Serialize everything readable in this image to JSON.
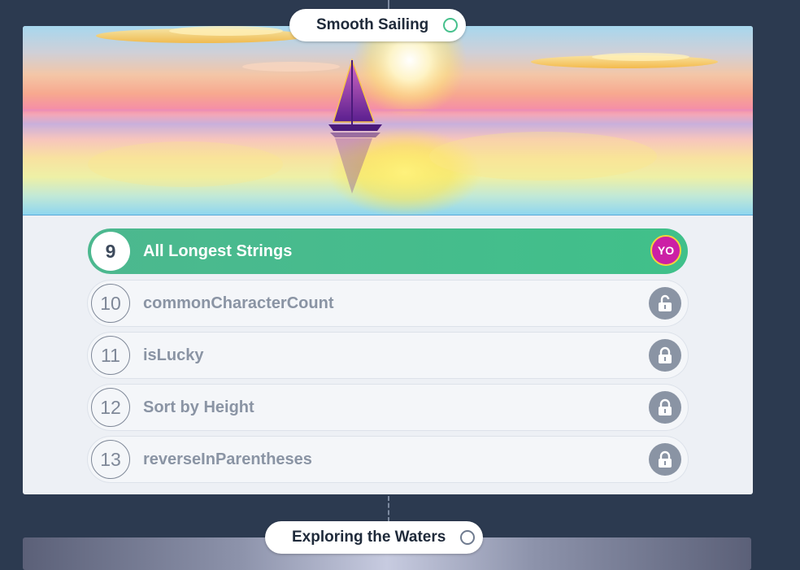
{
  "levels": [
    {
      "title": "Smooth Sailing",
      "status_icon": "circle-outline-icon",
      "accent": "#46c08c"
    },
    {
      "title": "Exploring the Waters",
      "status_icon": "circle-outline-icon",
      "accent": "#6f7b8f"
    }
  ],
  "tasks": [
    {
      "number": "9",
      "title": "All Longest Strings",
      "state": "current",
      "avatar": "YO"
    },
    {
      "number": "10",
      "title": "commonCharacterCount",
      "state": "unlocked-icon"
    },
    {
      "number": "11",
      "title": "isLucky",
      "state": "locked-icon"
    },
    {
      "number": "12",
      "title": "Sort by Height",
      "state": "locked-icon"
    },
    {
      "number": "13",
      "title": "reverseInParentheses",
      "state": "locked-icon"
    }
  ],
  "colors": {
    "background": "#2c3a50",
    "current_task": "#40c08a",
    "avatar": "#cc1fa5",
    "lock": "#8a94a4"
  }
}
